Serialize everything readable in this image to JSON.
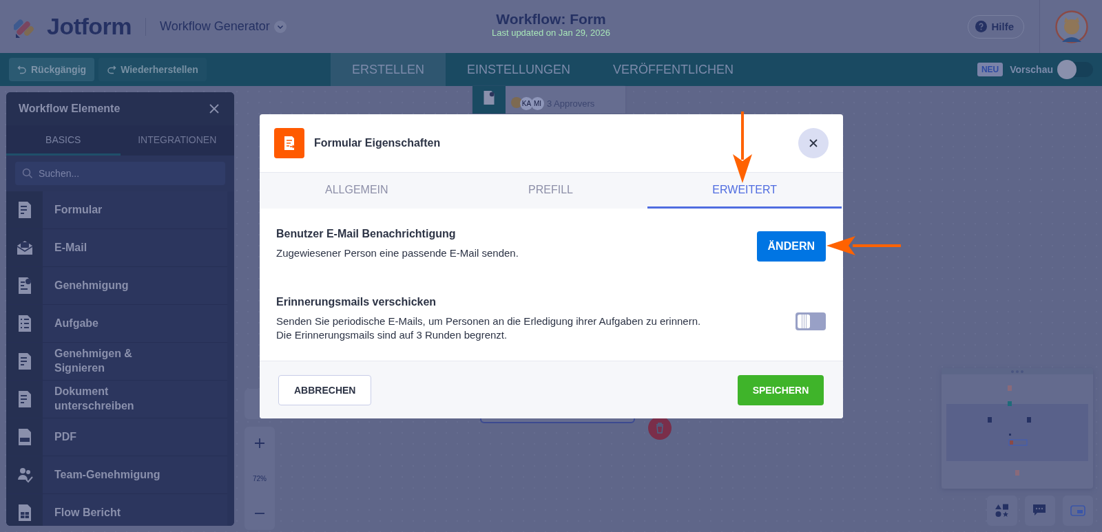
{
  "header": {
    "logo_text": "Jotform",
    "product": "Workflow Generator",
    "title": "Workflow: Form",
    "subtitle": "Last updated on Jan 29, 2026",
    "help": "Hilfe"
  },
  "toolbar": {
    "actions": [
      {
        "label": "Rückgängig",
        "kind": "undo",
        "disabled": false
      },
      {
        "label": "Wiederherstellen",
        "kind": "redo",
        "disabled": true
      }
    ],
    "tabs": [
      {
        "label": "ERSTELLEN",
        "selected": true
      },
      {
        "label": "EINSTELLUNGEN",
        "selected": false
      },
      {
        "label": "VERÖFFENTLICHEN",
        "selected": false
      }
    ],
    "badge": "NEU",
    "preview": {
      "label": "Vorschau",
      "on": false
    }
  },
  "sidebar": {
    "title": "Workflow Elemente",
    "tabs": [
      {
        "label": "BASICS",
        "selected": true
      },
      {
        "label": "INTEGRATIONEN",
        "selected": false
      }
    ],
    "search": {
      "placeholder": "Suchen..."
    },
    "items": [
      {
        "label": "Formular",
        "kind": "form"
      },
      {
        "label": "E-Mail",
        "kind": "email"
      },
      {
        "label": "Genehmigung",
        "kind": "approval"
      },
      {
        "label": "Aufgabe",
        "kind": "task"
      },
      {
        "label": "Genehmigen & Signieren",
        "kind": "sign"
      },
      {
        "label": "Dokument unterschreiben",
        "kind": "document"
      },
      {
        "label": "PDF",
        "kind": "pdf"
      },
      {
        "label": "Team-Genehmigung",
        "kind": "team"
      },
      {
        "label": "Flow Bericht",
        "kind": "report"
      }
    ]
  },
  "canvas": {
    "node": {
      "avatars": [
        "KA",
        "MI"
      ],
      "caption": "3 Approvers"
    },
    "zoom": "72%"
  },
  "modal": {
    "title": "Formular Eigenschaften",
    "tabs": [
      {
        "label": "ALLGEMEIN",
        "selected": false
      },
      {
        "label": "PREFILL",
        "selected": false
      },
      {
        "label": "ERWEITERT",
        "selected": true
      }
    ],
    "settings": [
      {
        "kind": "button",
        "title": "Benutzer E-Mail Benachrichtigung",
        "lines": [
          "Zugewiesener Person eine passende E-Mail senden."
        ],
        "button": "ÄNDERN"
      },
      {
        "kind": "toggle",
        "title": "Erinnerungsmails verschicken",
        "lines": [
          "Senden Sie periodische E-Mails, um Personen an die Erledigung ihrer Aufgaben zu erinnern.",
          "Die Erinnerungsmails sind auf 3 Runden begrenzt."
        ],
        "on": false
      }
    ],
    "cancel": "ABBRECHEN",
    "save": "SPEICHERN"
  }
}
